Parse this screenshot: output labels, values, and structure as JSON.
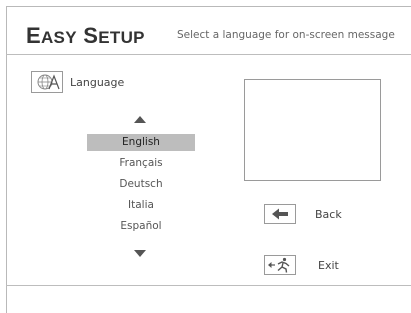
{
  "header": {
    "title_first_initial": "E",
    "title_first_rest": "ASY",
    "title_second_initial": "S",
    "title_second_rest": "ETUP",
    "subtitle": "Select a language for on-screen message"
  },
  "language_section": {
    "icon": "globe-letter-icon",
    "label": "Language",
    "items": [
      {
        "label": "English",
        "selected": true
      },
      {
        "label": "Français",
        "selected": false
      },
      {
        "label": "Deutsch",
        "selected": false
      },
      {
        "label": "Italia",
        "selected": false
      },
      {
        "label": "Español",
        "selected": false
      }
    ]
  },
  "actions": {
    "back": {
      "icon": "back-arrow-icon",
      "label": "Back"
    },
    "exit": {
      "icon": "exit-runner-icon",
      "label": "Exit"
    }
  },
  "colors": {
    "selected_background": "#bdbdbd",
    "text": "#333333",
    "border": "#9a9a9a"
  }
}
